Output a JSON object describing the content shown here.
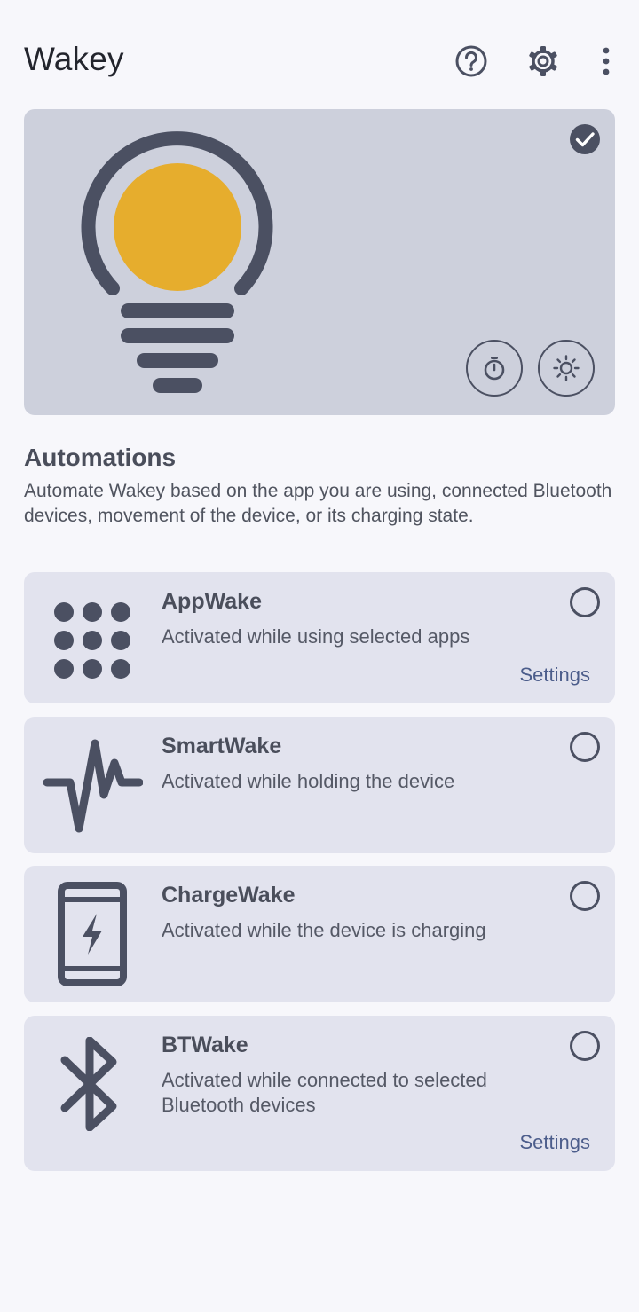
{
  "app": {
    "title": "Wakey"
  },
  "header_icons": [
    "help-icon",
    "settings-gear-icon",
    "more-vert-icon"
  ],
  "colors": {
    "background": "#f7f7fb",
    "hero_bg": "#cdd0dc",
    "card_bg": "#e2e3ee",
    "icon_dark": "#4b5062",
    "bulb_yellow": "#e6ad2d",
    "link": "#4c5d8b"
  },
  "hero": {
    "enabled": true,
    "buttons": [
      "timer-icon",
      "brightness-icon"
    ]
  },
  "automations": {
    "title": "Automations",
    "description": "Automate Wakey based on the app you are using, connected Bluetooth devices, movement of the device, or its charging state.",
    "items": [
      {
        "title": "AppWake",
        "subtitle": "Activated while using selected apps",
        "settings_label": "Settings",
        "checked": false,
        "icon": "apps-grid-icon"
      },
      {
        "title": "SmartWake",
        "subtitle": "Activated while holding the device",
        "checked": false,
        "icon": "activity-icon"
      },
      {
        "title": "ChargeWake",
        "subtitle": "Activated while the device is charging",
        "checked": false,
        "icon": "phone-charging-icon"
      },
      {
        "title": "BTWake",
        "subtitle": "Activated while connected to selected Bluetooth devices",
        "settings_label": "Settings",
        "checked": false,
        "icon": "bluetooth-icon"
      }
    ]
  }
}
